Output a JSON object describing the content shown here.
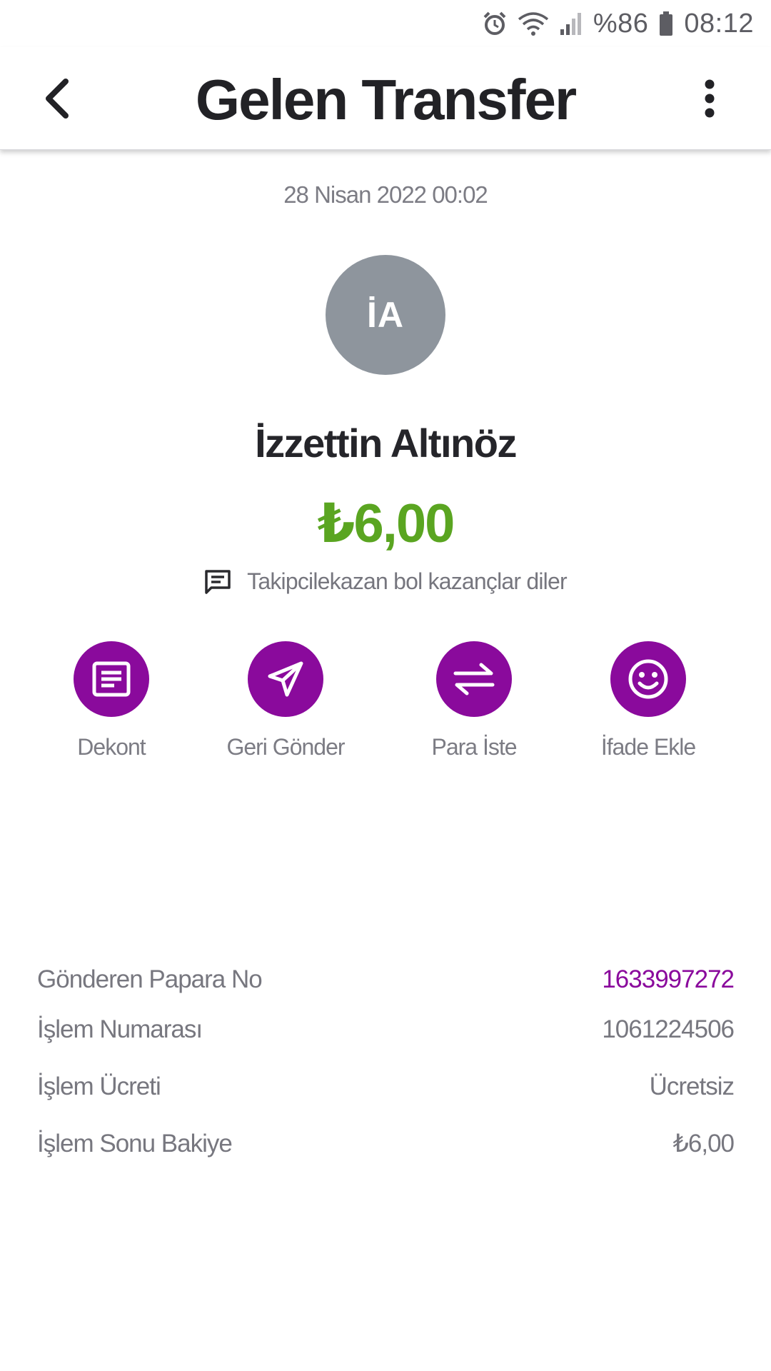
{
  "status_bar": {
    "battery": "%86",
    "time": "08:12",
    "icons": [
      "alarm-icon",
      "wifi-icon",
      "signal-icon",
      "battery-icon"
    ]
  },
  "app_bar": {
    "title": "Gelen Transfer",
    "back_icon": "chevron-left-icon",
    "menu_icon": "more-vertical-icon"
  },
  "transfer": {
    "date": "28 Nisan 2022 00:02",
    "avatar_initials": "İA",
    "sender_name": "İzzettin Altınöz",
    "amount": "₺6,00",
    "message": "Takipcilekazan bol kazançlar diler"
  },
  "actions": [
    {
      "label": "Dekont",
      "icon": "receipt-icon"
    },
    {
      "label": "Geri Gönder",
      "icon": "send-icon"
    },
    {
      "label": "Para İste",
      "icon": "transfer-arrows-icon"
    },
    {
      "label": "İfade Ekle",
      "icon": "smiley-icon"
    }
  ],
  "details": [
    {
      "label": "Gönderen Papara No",
      "value": "1633997272"
    },
    {
      "label": "İşlem Numarası",
      "value": "1061224506"
    },
    {
      "label": "İşlem Ücreti",
      "value": "Ücretsiz"
    },
    {
      "label": "İşlem Sonu Bakiye",
      "value": "₺6,00"
    }
  ],
  "colors": {
    "accent": "#8a0a9c",
    "amount_green": "#5aa521",
    "avatar_gray": "#8e959d"
  }
}
